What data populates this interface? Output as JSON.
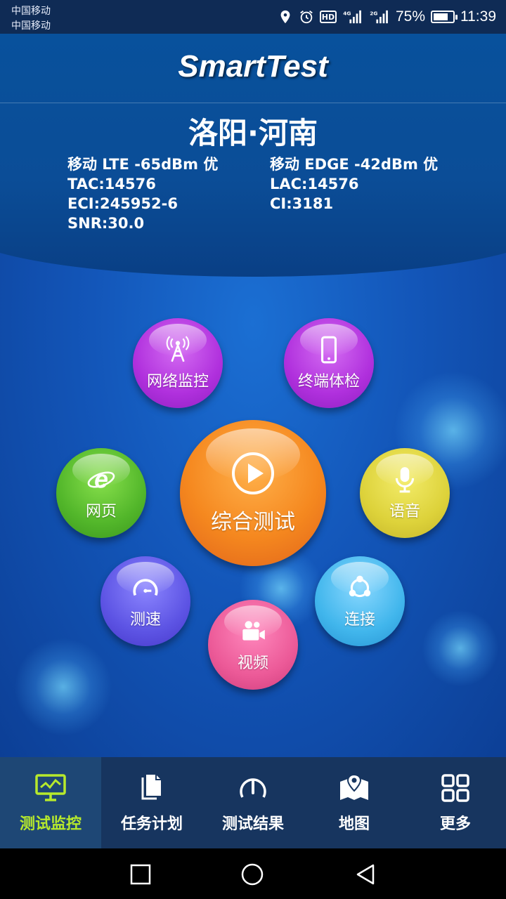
{
  "status_bar": {
    "carrier_1": "中国移动",
    "carrier_2": "中国移动",
    "hd": "HD",
    "net_1": "4G",
    "net_2": "2G",
    "battery": "75%",
    "battery_level": 0.75,
    "time": "11:39"
  },
  "header": {
    "app_title": "SmartTest",
    "location": "洛阳·河南"
  },
  "cell_info": {
    "left": [
      "移动 LTE -65dBm 优",
      "TAC:14576",
      "ECI:245952-6",
      "SNR:30.0"
    ],
    "right": [
      "移动 EDGE -42dBm 优",
      "LAC:14576",
      "CI:3181"
    ]
  },
  "functions": {
    "network_monitor": "网络监控",
    "terminal_check": "终端体检",
    "web": "网页",
    "comprehensive_test": "综合测试",
    "voice": "语音",
    "speed_test": "测速",
    "connect": "连接",
    "video": "视频"
  },
  "bottom_nav": {
    "items": [
      "测试监控",
      "任务计划",
      "测试结果",
      "地图",
      "更多"
    ],
    "active_index": 0
  },
  "colors": {
    "active_nav": "#b7ea2c",
    "nav_bg": "#17355f",
    "center_bubble": "#f5881f"
  }
}
